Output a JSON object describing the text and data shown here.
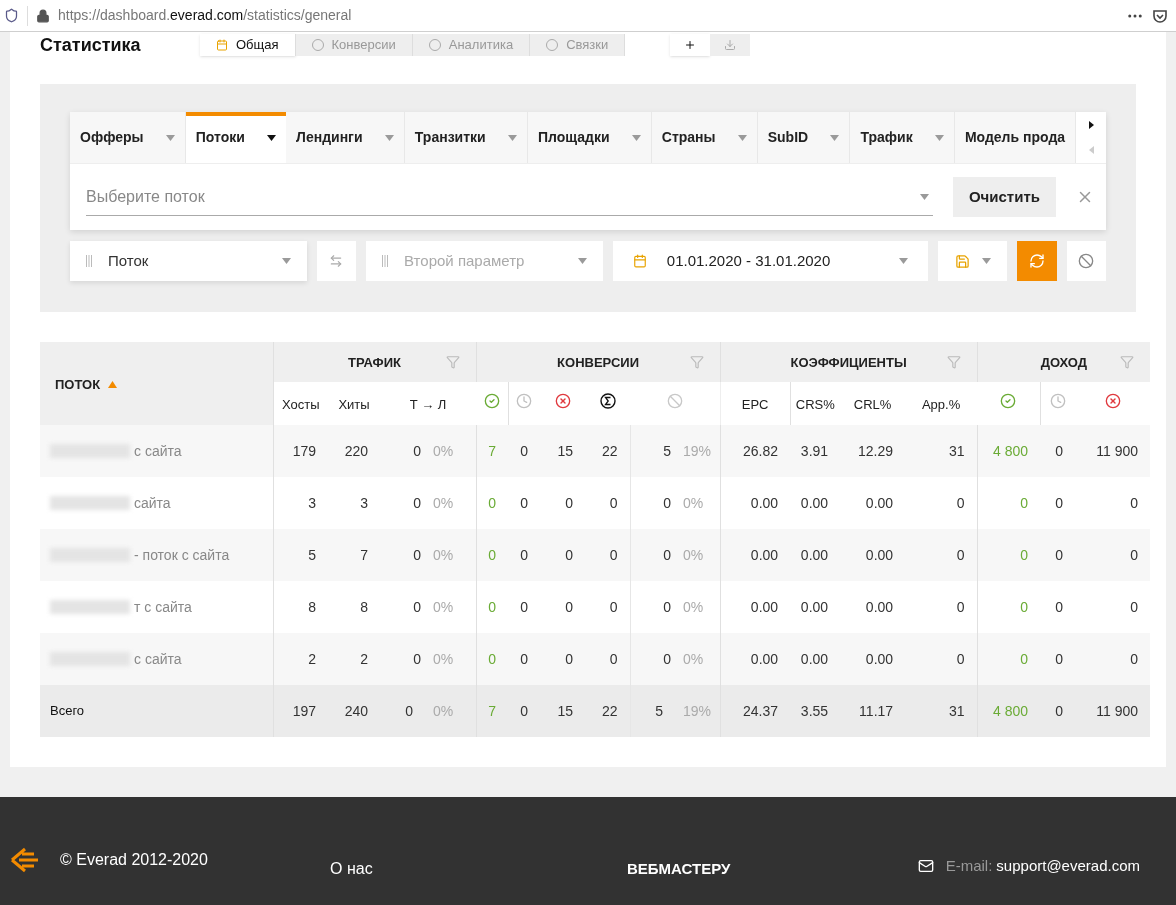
{
  "browser": {
    "url_prefix": "https://dashboard.",
    "url_domain": "everad.com",
    "url_path": "/statistics/general"
  },
  "page": {
    "title": "Статистика",
    "tabs": [
      {
        "label": "Общая",
        "selected": true
      },
      {
        "label": "Конверсии",
        "selected": false
      },
      {
        "label": "Аналитика",
        "selected": false
      },
      {
        "label": "Связки",
        "selected": false
      }
    ]
  },
  "filter_tabs": [
    {
      "label": "Офферы",
      "selected": false
    },
    {
      "label": "Потоки",
      "selected": true
    },
    {
      "label": "Лендинги",
      "selected": false
    },
    {
      "label": "Транзитки",
      "selected": false
    },
    {
      "label": "Площадки",
      "selected": false
    },
    {
      "label": "Страны",
      "selected": false
    },
    {
      "label": "SubID",
      "selected": false
    },
    {
      "label": "Трафик",
      "selected": false
    },
    {
      "label": "Модель прода",
      "selected": false
    }
  ],
  "filter": {
    "placeholder": "Выберите поток",
    "clear_button": "Очистить"
  },
  "controls": {
    "first_param": "Поток",
    "second_param_placeholder": "Второй параметр",
    "date_range": "01.01.2020 - 31.01.2020"
  },
  "table": {
    "name_header": "ПОТОК",
    "sort_ascending": true,
    "groups": [
      {
        "label": "ТРАФИК"
      },
      {
        "label": "КОНВЕРСИИ"
      },
      {
        "label": "КОЭФФИЦИЕНТЫ"
      },
      {
        "label": "ДОХОД"
      }
    ],
    "subheaders": [
      {
        "kind": "label",
        "label": "Хосты"
      },
      {
        "kind": "label",
        "label": "Хиты"
      },
      {
        "kind": "label",
        "label": "Т → Л"
      },
      {
        "kind": "approved"
      },
      {
        "kind": "pending"
      },
      {
        "kind": "rejected"
      },
      {
        "kind": "total"
      },
      {
        "kind": "trash"
      },
      {
        "kind": "label",
        "label": "EPC"
      },
      {
        "kind": "label",
        "label": "CRS%"
      },
      {
        "kind": "label",
        "label": "CRL%"
      },
      {
        "kind": "label",
        "label": "App.%"
      },
      {
        "kind": "approved"
      },
      {
        "kind": "pending"
      },
      {
        "kind": "rejected"
      }
    ],
    "rows": [
      {
        "name": "с сайта",
        "cells": [
          "179",
          "220",
          "0",
          "0%",
          "7",
          "0",
          "15",
          "22",
          "5",
          "19%",
          "26.82",
          "3.91",
          "12.29",
          "31",
          "4 800",
          "0",
          "11 900"
        ]
      },
      {
        "name": "сайта",
        "cells": [
          "3",
          "3",
          "0",
          "0%",
          "0",
          "0",
          "0",
          "0",
          "0",
          "0%",
          "0.00",
          "0.00",
          "0.00",
          "0",
          "0",
          "0",
          "0"
        ]
      },
      {
        "name": "- поток с сайта",
        "cells": [
          "5",
          "7",
          "0",
          "0%",
          "0",
          "0",
          "0",
          "0",
          "0",
          "0%",
          "0.00",
          "0.00",
          "0.00",
          "0",
          "0",
          "0",
          "0"
        ]
      },
      {
        "name": "т с сайта",
        "cells": [
          "8",
          "8",
          "0",
          "0%",
          "0",
          "0",
          "0",
          "0",
          "0",
          "0%",
          "0.00",
          "0.00",
          "0.00",
          "0",
          "0",
          "0",
          "0"
        ]
      },
      {
        "name": "с сайта",
        "cells": [
          "2",
          "2",
          "0",
          "0%",
          "0",
          "0",
          "0",
          "0",
          "0",
          "0%",
          "0.00",
          "0.00",
          "0.00",
          "0",
          "0",
          "0",
          "0"
        ]
      }
    ],
    "total": {
      "name": "Всего",
      "cells": [
        "197",
        "240",
        "0",
        "0%",
        "7",
        "0",
        "15",
        "22",
        "5",
        "19%",
        "24.37",
        "3.55",
        "11.17",
        "31",
        "4 800",
        "0",
        "11 900"
      ]
    }
  },
  "footer": {
    "copyright": "© Everad 2012-2020",
    "about_link": "О нас",
    "webmaster_link": "ВЕБМАСТЕРУ",
    "email_label": "E-mail:",
    "email": "support@everad.com"
  }
}
